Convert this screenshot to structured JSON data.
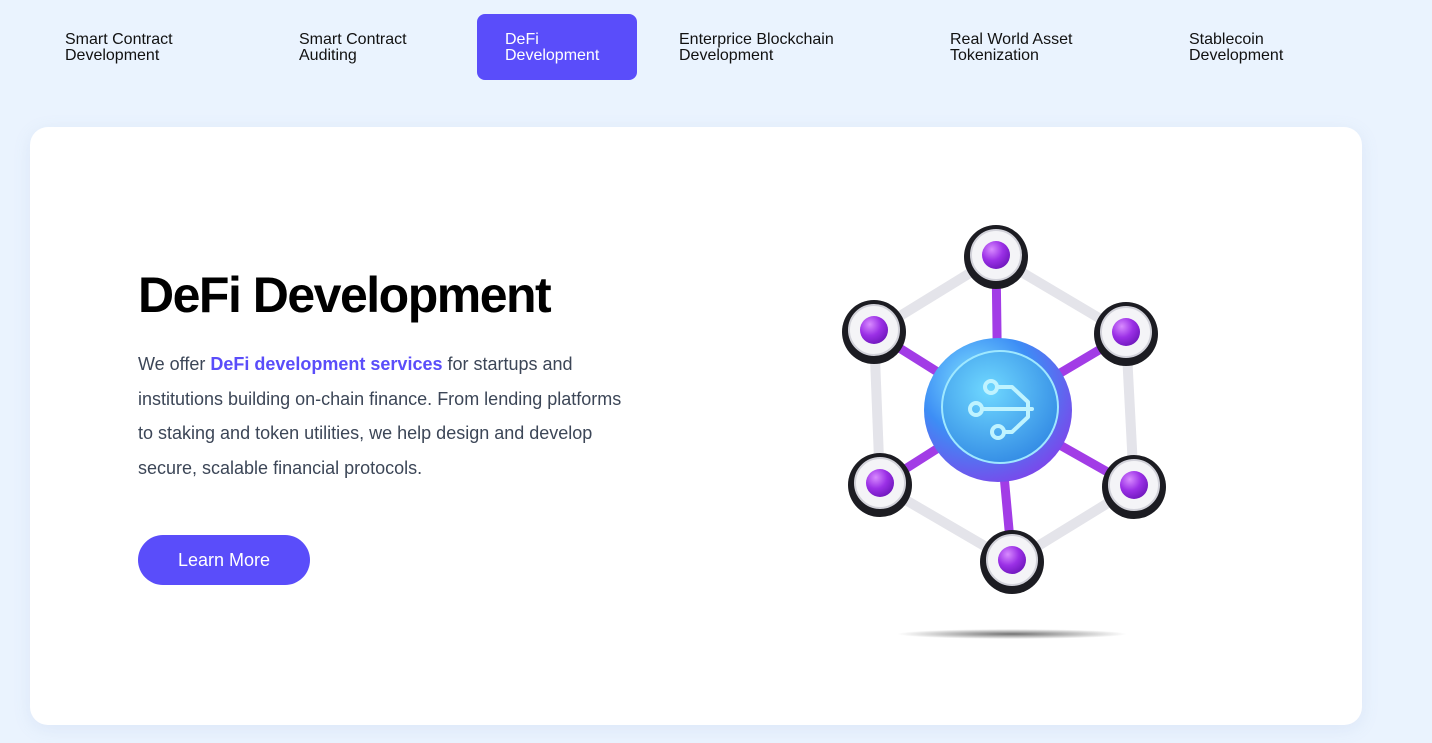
{
  "tabs": [
    {
      "line1": "Smart Contract",
      "line2": "Development"
    },
    {
      "line1": "Smart Contract",
      "line2": "Auditing"
    },
    {
      "line1": "DeFi",
      "line2": "Development"
    },
    {
      "line1": "Enterprice Blockchain",
      "line2": "Development"
    },
    {
      "line1": "Real World Asset",
      "line2": "Tokenization"
    },
    {
      "line1": "Stablecoin",
      "line2": "Development"
    }
  ],
  "active_tab_index": 2,
  "content": {
    "title": "DeFi Development",
    "desc_before": "We offer ",
    "desc_highlight": "DeFi development services",
    "desc_after": " for startups and institutions building on-chain finance. From lending platforms to staking and token utilities, we help design and develop secure, scalable financial protocols.",
    "button_label": "Learn More"
  },
  "colors": {
    "accent": "#5a4dfa",
    "page_background": "#eaf3fe",
    "node_purple": "#9b30e6",
    "hub_cyan": "#2ab6f0"
  },
  "illustration": {
    "icon": "blockchain-network-icon",
    "hub_icon": "circuit-icon"
  }
}
